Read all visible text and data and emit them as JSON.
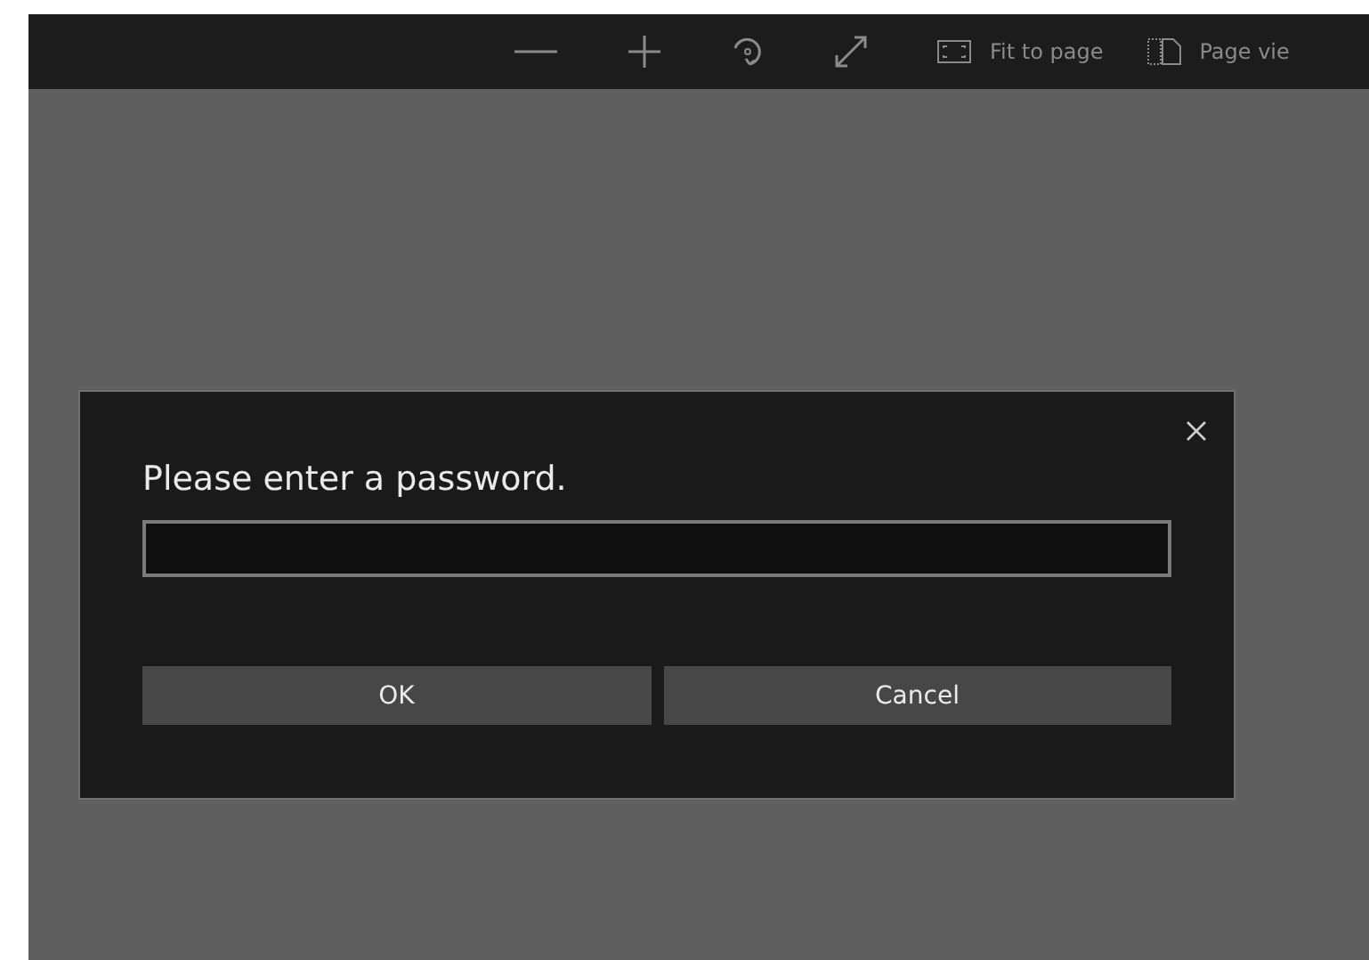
{
  "toolbar": {
    "items": [
      {
        "kind": "zoom-out"
      },
      {
        "kind": "zoom-in"
      },
      {
        "kind": "rotate"
      },
      {
        "kind": "expand"
      },
      {
        "kind": "fit",
        "label": "Fit to page"
      },
      {
        "kind": "page",
        "label": "Page vie"
      }
    ]
  },
  "dialog": {
    "title": "Please enter a password.",
    "buttons": [
      "OK",
      "Cancel"
    ]
  }
}
